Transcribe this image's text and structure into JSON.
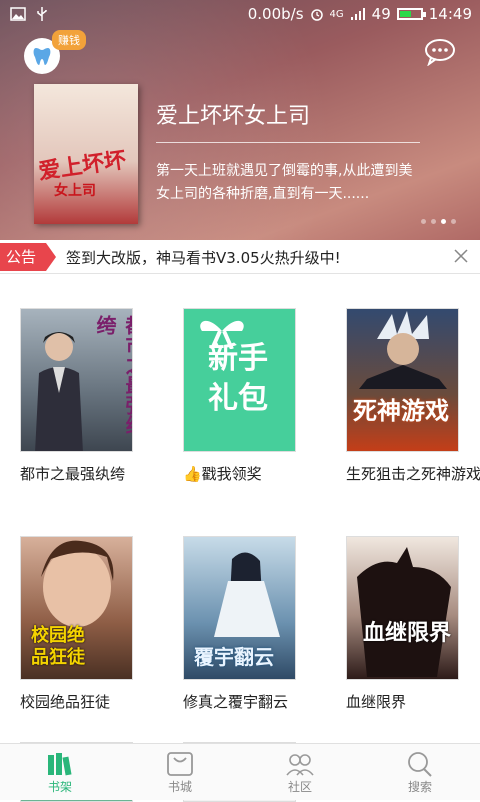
{
  "status": {
    "network_speed": "0.00b/s",
    "signal": "4G",
    "battery": "49",
    "battery_level": 0.49,
    "time": "14:49"
  },
  "hero": {
    "earn_badge": "赚钱",
    "title": "爱上坏坏女上司",
    "description": "第一天上班就遇见了倒霉的事,从此遭到美女上司的各种折磨,直到有一天......",
    "cover_title": "爱上坏坏",
    "cover_sub": "女上司",
    "page_count": 4,
    "active_page": 3
  },
  "notice": {
    "tag": "公告",
    "text": "签到大改版，神马看书V3.05火热升级中!"
  },
  "books": [
    {
      "label": "都市之最强纨绔",
      "cover_text": "都市之最强纨绔"
    },
    {
      "label": "👍戳我领奖",
      "cover_text": "新手礼包"
    },
    {
      "label": "生死狙击之死神游戏",
      "cover_text": "死神游戏"
    },
    {
      "label": "校园绝品狂徒",
      "cover_text": "校园绝品狂徒"
    },
    {
      "label": "修真之覆宇翻云",
      "cover_text": "覆宇翻云"
    },
    {
      "label": "血继限界",
      "cover_text": "血继限界"
    }
  ],
  "tabs": [
    {
      "label": "书架",
      "icon": "bookshelf-icon",
      "active": true
    },
    {
      "label": "书城",
      "icon": "bookstore-bag-icon",
      "active": false
    },
    {
      "label": "社区",
      "icon": "community-icon",
      "active": false
    },
    {
      "label": "搜索",
      "icon": "search-icon",
      "active": false
    }
  ],
  "colors": {
    "accent": "#2ab67a",
    "notice_red": "#e8454c",
    "badge_orange": "#f2a23a"
  }
}
